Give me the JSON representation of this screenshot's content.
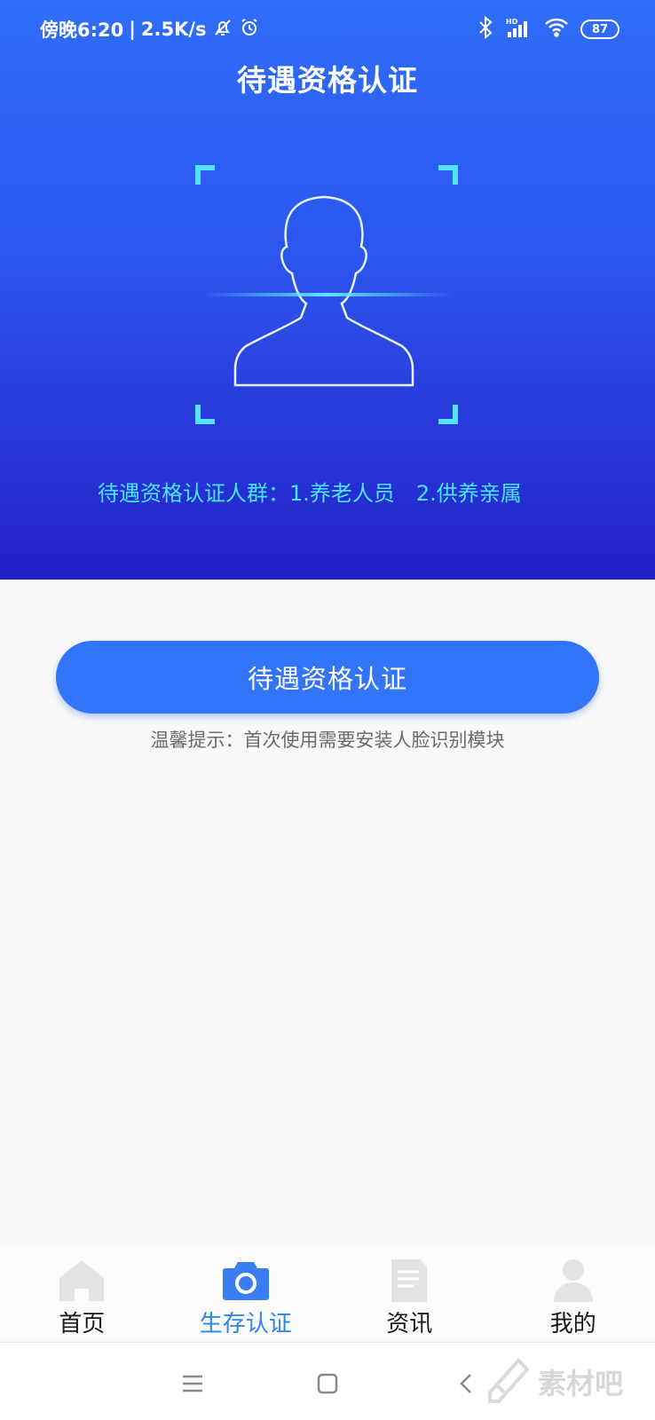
{
  "status_bar": {
    "time": "傍晚6:20",
    "net_speed": "2.5K/s",
    "battery": "87",
    "icons": [
      "mute-bell-icon",
      "alarm-icon",
      "bluetooth-icon",
      "hd-signal-icon",
      "wifi-icon",
      "battery-icon"
    ]
  },
  "header": {
    "title": "待遇资格认证"
  },
  "hero": {
    "notice": "待遇资格认证人群：1.养老人员　2.供养亲属"
  },
  "main": {
    "primary_button": "待遇资格认证",
    "tip": "温馨提示：首次使用需要安装人脸识别模块"
  },
  "tabbar": {
    "tabs": [
      {
        "label": "首页",
        "icon": "home-icon",
        "active": false
      },
      {
        "label": "生存认证",
        "icon": "camera-icon",
        "active": true
      },
      {
        "label": "资讯",
        "icon": "document-icon",
        "active": false
      },
      {
        "label": "我的",
        "icon": "person-icon",
        "active": false
      }
    ]
  },
  "system_nav": {
    "icons": [
      "menu-icon",
      "home-square-icon",
      "back-icon"
    ]
  },
  "watermark": {
    "text": "素材吧"
  },
  "colors": {
    "primary": "#3275fb",
    "hero_top": "#2f6ef9",
    "hero_bottom": "#2420c8",
    "accent_cyan": "#48e6ff",
    "tab_active": "#2e86e8"
  }
}
